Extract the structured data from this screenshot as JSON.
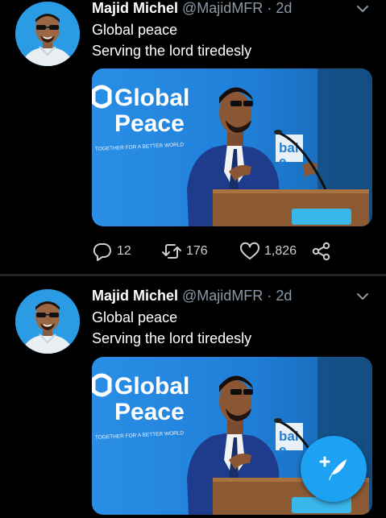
{
  "tweets": [
    {
      "name": "Majid Michel",
      "handle": "@MajidMFR",
      "time": "· 2d",
      "lines": [
        "Global peace",
        "Serving the lord tiredesly"
      ],
      "media": {
        "banner_title_1": "Global",
        "banner_title_2": "Peace",
        "banner_tagline": "TOGETHER FOR A BETTER WORLD",
        "podium_fragment_1": "bal",
        "podium_fragment_2": "e"
      },
      "actions": {
        "replies": "12",
        "retweets": "176",
        "likes": "1,826"
      }
    },
    {
      "name": "Majid Michel",
      "handle": "@MajidMFR",
      "time": "· 2d",
      "lines": [
        "Global peace",
        "Serving the lord tiredesly"
      ],
      "media": {
        "banner_title_1": "Global",
        "banner_title_2": "Peace",
        "banner_tagline": "TOGETHER FOR A BETTER WORLD",
        "podium_fragment_1": "bal",
        "podium_fragment_2": "e"
      }
    }
  ],
  "icons": {
    "reply": "speech-bubble-icon",
    "retweet": "retweet-icon",
    "like": "heart-icon",
    "share": "share-icon",
    "compose": "feather-plus-icon",
    "more": "chevron-down-icon"
  },
  "colors": {
    "accent": "#1da1f2",
    "muted": "#8b98a5",
    "background": "#000000"
  }
}
